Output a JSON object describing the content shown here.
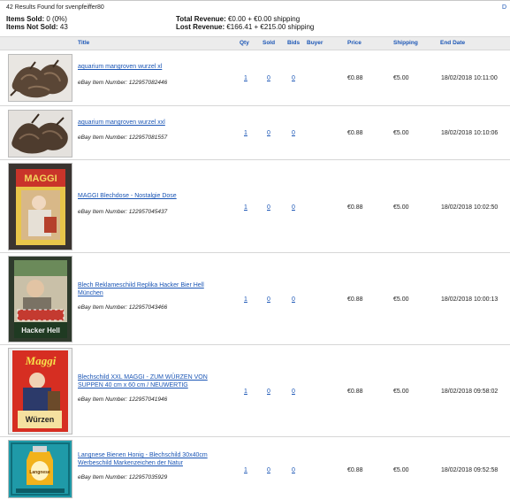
{
  "header": {
    "results_text": "42 Results Found for svenpfeiffer80",
    "corner_link": "D",
    "items_sold_label": "Items Sold:",
    "items_sold_value": "0 (0%)",
    "items_not_sold_label": "Items Not Sold:",
    "items_not_sold_value": "43",
    "total_revenue_label": "Total Revenue:",
    "total_revenue_value": "€0.00 + €0.00 shipping",
    "lost_revenue_label": "Lost Revenue:",
    "lost_revenue_value": "€166.41 + €215.00 shipping"
  },
  "columns": {
    "title": "Title",
    "qty": "Qty",
    "sold": "Sold",
    "bids": "Bids",
    "buyer": "Buyer",
    "price": "Price",
    "shipping": "Shipping",
    "end_date": "End Date"
  },
  "rows": [
    {
      "title": "aquarium mangroven wurzel xl",
      "item_number": "eBay Item Number: 122957082446",
      "qty": "1",
      "sold": "0",
      "bids": "0",
      "buyer": "",
      "price": "€0.88",
      "shipping": "€5.00",
      "end_date": "18/02/2018 10:11:00",
      "image": "wood-roots"
    },
    {
      "title": "aquarium mangroven wurzel xxl",
      "item_number": "eBay Item Number: 122957081557",
      "qty": "1",
      "sold": "0",
      "bids": "0",
      "buyer": "",
      "price": "€0.88",
      "shipping": "€5.00",
      "end_date": "18/02/2018 10:10:06",
      "image": "wood-roots"
    },
    {
      "title": "MAGGI Blechdose - Nostalgie Dose",
      "item_number": "eBay Item Number: 122957045437",
      "qty": "1",
      "sold": "0",
      "bids": "0",
      "buyer": "",
      "price": "€0.88",
      "shipping": "€5.00",
      "end_date": "18/02/2018 10:02:50",
      "image": "maggi-tin",
      "image_text": "MAGGI"
    },
    {
      "title": "Blech Reklameschild Replika Hacker Bier Hell München",
      "item_number": "eBay Item Number: 122957043466",
      "qty": "1",
      "sold": "0",
      "bids": "0",
      "buyer": "",
      "price": "€0.88",
      "shipping": "€5.00",
      "end_date": "18/02/2018 10:00:13",
      "image": "hacker-sign",
      "image_text": "Hacker Hell"
    },
    {
      "title": "Blechschild XXL MAGGI - ZUM WÜRZEN VON SUPPEN 40 cm x 60 cm / NEUWERTIG",
      "item_number": "eBay Item Number: 122957041946",
      "qty": "1",
      "sold": "0",
      "bids": "0",
      "buyer": "",
      "price": "€0.88",
      "shipping": "€5.00",
      "end_date": "18/02/2018 09:58:02",
      "image": "maggi-sign",
      "image_text_top": "Maggi",
      "image_text_bottom": "Würzen"
    },
    {
      "title": "Langnese Bienen Honig - Blechschild 30x40cm Werbeschild Markenzeichen der Natur",
      "item_number": "eBay Item Number: 122957035929",
      "qty": "1",
      "sold": "0",
      "bids": "0",
      "buyer": "",
      "price": "€0.88",
      "shipping": "€5.00",
      "end_date": "18/02/2018 09:52:58",
      "image": "honey-sign",
      "image_text": "Langnese"
    }
  ],
  "colors": {
    "link": "#1a55b5",
    "header_bg": "#ececec",
    "row_border": "#d6d6d6"
  }
}
